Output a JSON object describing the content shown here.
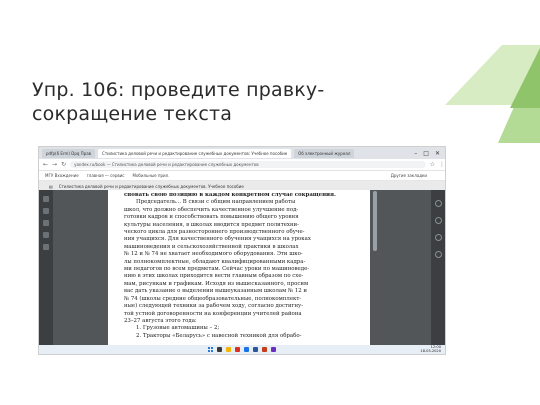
{
  "slide": {
    "title": "Упр. 106: проведите правку-сокращение текста"
  },
  "screenshot": {
    "tabs": [
      {
        "label": "pdfp(6 Erm) Dpq Прав",
        "active": false
      },
      {
        "label": "Стилистика деловой речи и редактирование служебных документов: Учебное пособие",
        "active": true
      },
      {
        "label": "Об электронный журнал",
        "active": false
      }
    ],
    "url": "yandex.ru/book — Стилистика деловой речи и редактирование служебных документов",
    "bookmarks": [
      "МГУ Вхождение",
      "главная — сервис",
      "Мобильные прил."
    ],
    "bookmarks_right": "Другие закладки",
    "file_bar": "Стилистика деловой речи и редактирование служебных документов. Учебное пособие",
    "tray_time": "12:00",
    "tray_date": "18.03.2020",
    "page_lines": [
      {
        "text": "сновать свою позицию в каждом конкретном случае сокращения.",
        "style": "bold"
      },
      {
        "text": "Председатель... В связи с общим направлением работы",
        "style": "indent"
      },
      {
        "text": "школ, что должно обеспечить качественное улучшение под-",
        "style": ""
      },
      {
        "text": "готовки кадров и способствовать повышению общего уровня",
        "style": ""
      },
      {
        "text": "культуры населения, в школах вводится предмет политехни-",
        "style": ""
      },
      {
        "text": "ческого цикла для разностороннего производственного обуче-",
        "style": ""
      },
      {
        "text": "ния учащихся. Для качественного обучения учащихся на уроках",
        "style": ""
      },
      {
        "text": "машиноведения и сельскохозяйственной практики в школах",
        "style": ""
      },
      {
        "text": "№ 12 и № 74 не хватает необходимого оборудования. Эти шко-",
        "style": ""
      },
      {
        "text": "лы полнокомплектные, обладают квалифицированными кадра-",
        "style": ""
      },
      {
        "text": "ми педагогов по всем предметам. Сейчас уроки по машиноведе-",
        "style": ""
      },
      {
        "text": "нию в этих школах приходится вести главным образом по схе-",
        "style": ""
      },
      {
        "text": "мам, рисункам и графикам. Исходя из вышесказанного, просим",
        "style": ""
      },
      {
        "text": "вас дать указание о выделении вышеуказанным школам № 12 и",
        "style": ""
      },
      {
        "text": "№ 74 (школы средние общеобразовательные, полнокомплект-",
        "style": ""
      },
      {
        "text": "ные) следующей техники за рабочем ходу, согласно достигну-",
        "style": ""
      },
      {
        "text": "той устной договоренности на конференции учителей района",
        "style": ""
      },
      {
        "text": "23–27 августа этого года:",
        "style": ""
      },
      {
        "text": "1. Грузовые автомашины – 2;",
        "style": "indent"
      },
      {
        "text": "2. Тракторы «Беларусь» с навесной техникой для обрабо-",
        "style": "indent"
      }
    ]
  },
  "colors": {
    "deco_light": "#d8ecc3",
    "deco_mid": "#b4db96",
    "deco_dark": "#8fc46a",
    "title_text": "#2b2b2b"
  }
}
